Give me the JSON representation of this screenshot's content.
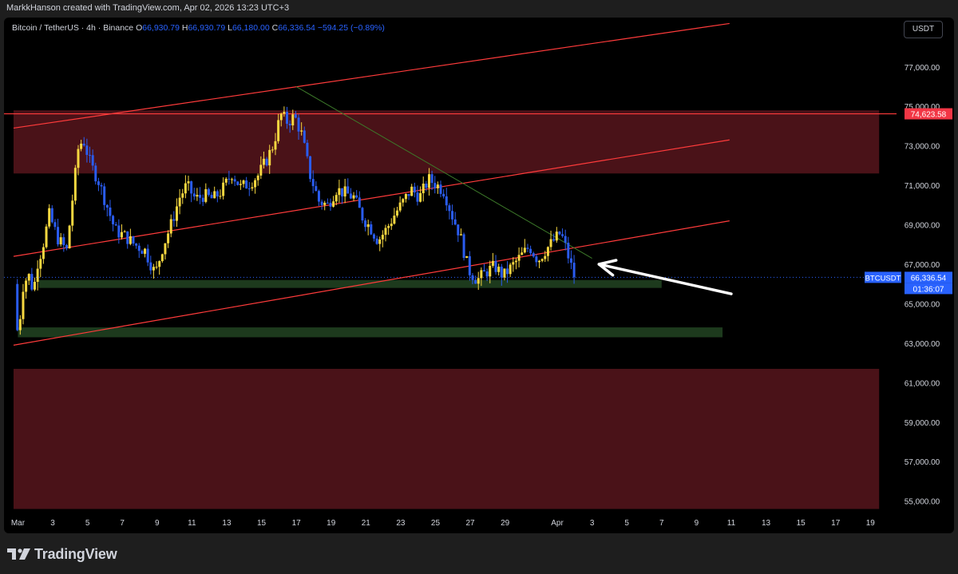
{
  "header": {
    "attribution": "MarkkHanson created with TradingView.com, Apr 02, 2026 13:23 UTC+3"
  },
  "legend": {
    "symbol": "Bitcoin / TetherUS · 4h · Binance",
    "open_label": "O",
    "open": "66,930.79",
    "high_label": "H",
    "high": "66,930.79",
    "low_label": "L",
    "low": "66,180.00",
    "close_label": "C",
    "close": "66,336.54",
    "change": "−594.25 (−0.89%)"
  },
  "currency_button": "USDT",
  "price_labels": {
    "resistance": "74,623.58",
    "symbol": "BTCUSDT",
    "last": "66,336.54",
    "countdown": "01:36:07"
  },
  "footer": {
    "brand": "TradingView"
  },
  "colors": {
    "up": "#f6d740",
    "down": "#2a5cf0",
    "zone_red": "#4a1218",
    "zone_green": "#1d3a1d",
    "channel": "#ff3b3b",
    "trendline": "#3d7a2a",
    "arrow": "#ffffff",
    "resistance_label": "#f23645",
    "last_label": "#2962ff"
  },
  "chart_data": {
    "type": "candlestick",
    "symbol": "BTCUSDT",
    "timeframe": "4h",
    "y_range": [
      54500,
      79500
    ],
    "y_ticks": [
      55000,
      57000,
      59000,
      61000,
      63000,
      65000,
      67000,
      69000,
      71000,
      73000,
      75000,
      77000
    ],
    "y_tick_labels": [
      "55,000.00",
      "57,000.00",
      "59,000.00",
      "61,000.00",
      "63,000.00",
      "65,000.00",
      "67,000.00",
      "69,000.00",
      "71,000.00",
      "73,000.00",
      "75,000.00",
      "77,000.00"
    ],
    "x_range": [
      0.75,
      20.1
    ],
    "x_ticks": [
      1,
      3,
      5,
      7,
      9,
      11,
      13,
      15,
      17,
      19,
      21,
      23,
      25,
      27,
      29,
      32,
      34,
      36,
      38,
      40,
      42,
      44,
      46,
      48,
      50
    ],
    "x_tick_labels": [
      "Mar",
      "3",
      "5",
      "7",
      "9",
      "11",
      "13",
      "15",
      "17",
      "19",
      "21",
      "23",
      "25",
      "27",
      "29",
      "Apr",
      "3",
      "5",
      "7",
      "9",
      "11",
      "13",
      "15",
      "17",
      "19"
    ],
    "price_series": [
      [
        0.8,
        66000
      ],
      [
        1.0,
        63200
      ],
      [
        1.3,
        65900
      ],
      [
        1.6,
        66500
      ],
      [
        1.9,
        65600
      ],
      [
        2.1,
        67000
      ],
      [
        2.4,
        67800
      ],
      [
        2.8,
        69500
      ],
      [
        3.3,
        68300
      ],
      [
        3.8,
        67700
      ],
      [
        4.2,
        70800
      ],
      [
        4.5,
        73100
      ],
      [
        4.8,
        73200
      ],
      [
        5.2,
        72000
      ],
      [
        5.6,
        71300
      ],
      [
        6.1,
        70000
      ],
      [
        6.6,
        68700
      ],
      [
        7.2,
        68400
      ],
      [
        7.7,
        68000
      ],
      [
        8.3,
        67700
      ],
      [
        8.9,
        66500
      ],
      [
        9.3,
        67800
      ],
      [
        9.8,
        69000
      ],
      [
        10.3,
        70400
      ],
      [
        10.7,
        71000
      ],
      [
        11.2,
        70300
      ],
      [
        11.7,
        70500
      ],
      [
        12.2,
        70300
      ],
      [
        12.7,
        70700
      ],
      [
        13.3,
        71600
      ],
      [
        13.8,
        70900
      ],
      [
        14.3,
        71100
      ],
      [
        14.8,
        71500
      ],
      [
        15.3,
        72300
      ],
      [
        15.7,
        73100
      ],
      [
        16.1,
        74600
      ],
      [
        16.5,
        74200
      ],
      [
        16.9,
        74500
      ],
      [
        17.3,
        73600
      ],
      [
        17.8,
        71500
      ],
      [
        18.3,
        70200
      ],
      [
        18.8,
        70000
      ],
      [
        19.3,
        70800
      ],
      [
        19.8,
        70600
      ],
      [
        20.3,
        70400
      ],
      [
        20.8,
        69400
      ],
      [
        21.3,
        68800
      ],
      [
        21.7,
        68200
      ],
      [
        22.2,
        68800
      ],
      [
        22.7,
        69600
      ],
      [
        23.1,
        70100
      ],
      [
        23.6,
        70800
      ],
      [
        24.1,
        70400
      ],
      [
        24.6,
        71300
      ],
      [
        25.1,
        71000
      ],
      [
        25.5,
        70700
      ],
      [
        25.9,
        69600
      ],
      [
        26.4,
        68500
      ],
      [
        26.9,
        66700
      ],
      [
        27.4,
        66200
      ],
      [
        27.9,
        66600
      ],
      [
        28.4,
        66900
      ],
      [
        28.9,
        66400
      ],
      [
        29.4,
        66900
      ],
      [
        29.9,
        67400
      ],
      [
        30.4,
        67900
      ],
      [
        30.9,
        67200
      ],
      [
        31.3,
        67700
      ],
      [
        31.8,
        68200
      ],
      [
        32.2,
        68600
      ],
      [
        32.5,
        67800
      ],
      [
        32.8,
        66900
      ],
      [
        33.1,
        66336
      ]
    ],
    "channel_lines": [
      {
        "from": [
          0.75,
          67400
        ],
        "to": [
          41.9,
          73300
        ]
      },
      {
        "from": [
          0.75,
          73900
        ],
        "to": [
          41.9,
          79200
        ]
      },
      {
        "from": [
          0.75,
          62900
        ],
        "to": [
          41.9,
          69200
        ]
      }
    ],
    "trendline": {
      "from": [
        17.0,
        76000
      ],
      "to": [
        34.0,
        67300
      ]
    },
    "zones": [
      {
        "kind": "resistance",
        "y1": 71600,
        "y2": 74800,
        "x1": 0.75,
        "x2": 50.5
      },
      {
        "kind": "demand",
        "y1": 65800,
        "y2": 66200,
        "x1": 2.2,
        "x2": 38.0
      },
      {
        "kind": "demand",
        "y1": 63300,
        "y2": 63800,
        "x1": 1.0,
        "x2": 41.5
      },
      {
        "kind": "resistance",
        "y1": 54600,
        "y2": 61700,
        "x1": 0.75,
        "x2": 50.5
      }
    ],
    "horizontal_line": 74623.58,
    "last_price": 66336.54,
    "arrow": {
      "tail": [
        42.0,
        65500
      ],
      "head": [
        34.4,
        67000
      ]
    }
  }
}
